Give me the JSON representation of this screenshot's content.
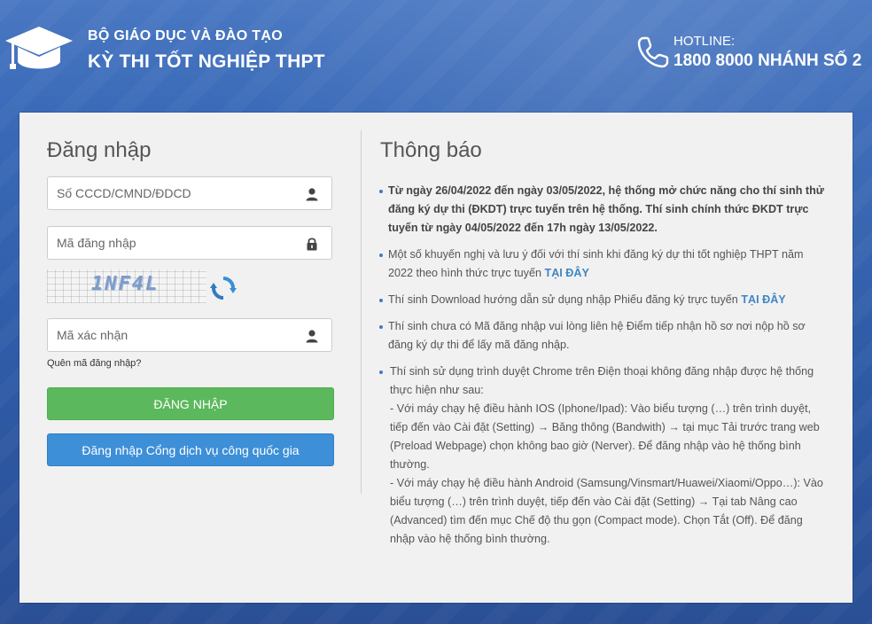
{
  "header": {
    "org_name": "BỘ GIÁO DỤC VÀ ĐÀO TẠO",
    "exam_name": "KỲ THI TỐT NGHIỆP THPT",
    "hotline_label": "HOTLINE:",
    "hotline_number": "1800 8000 NHÁNH SỐ 2",
    "icons": {
      "logo": "graduation-cap-icon",
      "phone": "phone-icon"
    }
  },
  "login": {
    "title": "Đăng nhập",
    "id_placeholder": "Số CCCD/CMND/ĐDCD",
    "code_placeholder": "Mã đăng nhập",
    "captcha_text": "1NF4L",
    "verify_placeholder": "Mã xác nhận",
    "forgot_label": "Quên mã đăng nhập?",
    "login_button": "ĐĂNG NHẬP",
    "national_button": "Đăng nhập Cổng dịch vụ công quốc gia"
  },
  "notice": {
    "title": "Thông báo",
    "item1": "Từ ngày 26/04/2022 đến ngày 03/05/2022, hệ thống mở chức năng cho thí sinh thử đăng ký dự thi (ĐKDT) trực tuyến trên hệ thống. Thí sinh chính thức ĐKDT trực tuyến từ ngày 04/05/2022 đến 17h ngày 13/05/2022.",
    "item2_text": "Một số khuyến nghị và lưu ý đối với thí sinh khi đăng ký dự thi tốt nghiệp THPT năm 2022 theo hình thức trực tuyến ",
    "item2_link": "TẠI ĐÂY",
    "item3_text": "Thí sinh Download hướng dẫn sử dụng nhập Phiếu đăng ký trực tuyến ",
    "item3_link": "TẠI ĐÂY",
    "item4": "Thí sinh chưa có Mã đăng nhập vui lòng liên hệ Điểm tiếp nhận hồ sơ nơi nộp hồ sơ đăng ký dự thi để lấy mã đăng nhập.",
    "item5_intro": "Thí sinh sử dụng trình duyệt Chrome trên Điện thoại không đăng nhập được hệ thống thực hiện như sau:",
    "item5_ios": " - Với máy chạy hệ điều hành IOS (Iphone/Ipad): Vào biểu tượng (…) trên trình duyệt, tiếp đến vào Cài đặt (Setting) → Băng thông (Bandwith) → tại mục Tải trước trang web (Preload Webpage) chọn không bao giờ (Nerver). Để đăng nhập vào hệ thống bình thường.",
    "item5_android": " - Với máy chạy hệ điều hành Android (Samsung/Vinsmart/Huawei/Xiaomi/Oppo…): Vào biểu tượng (…) trên trình duyệt, tiếp đến vào Cài đặt (Setting) → Tại tab Nâng cao (Advanced) tìm đến mục Chế độ thu gọn (Compact mode). Chọn Tắt (Off). Để đăng nhập vào hệ thống bình thường."
  },
  "colors": {
    "background": "#3a6ab8",
    "login_button": "#5cb85c",
    "national_button": "#3d8fd8",
    "link": "#3d86c6"
  }
}
